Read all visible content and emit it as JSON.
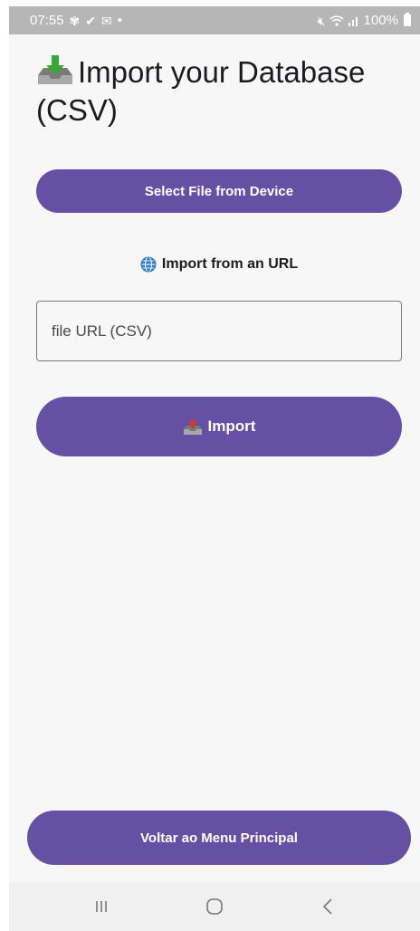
{
  "status_bar": {
    "time": "07:55",
    "left_icons": [
      "fan-icon",
      "check-icon",
      "mail-icon"
    ],
    "dot": "•",
    "battery": "100%"
  },
  "page": {
    "title": "Import your Database (CSV)",
    "select_file_button": "Select File from Device",
    "url_heading": "Import from an URL",
    "url_input_placeholder": "file URL (CSV)",
    "url_input_value": "",
    "import_button": "Import",
    "back_button": "Voltar ao Menu Principal"
  },
  "colors": {
    "primary": "#6550a4",
    "background": "#f7f7f7",
    "status_bar": "#b6b6b6"
  }
}
